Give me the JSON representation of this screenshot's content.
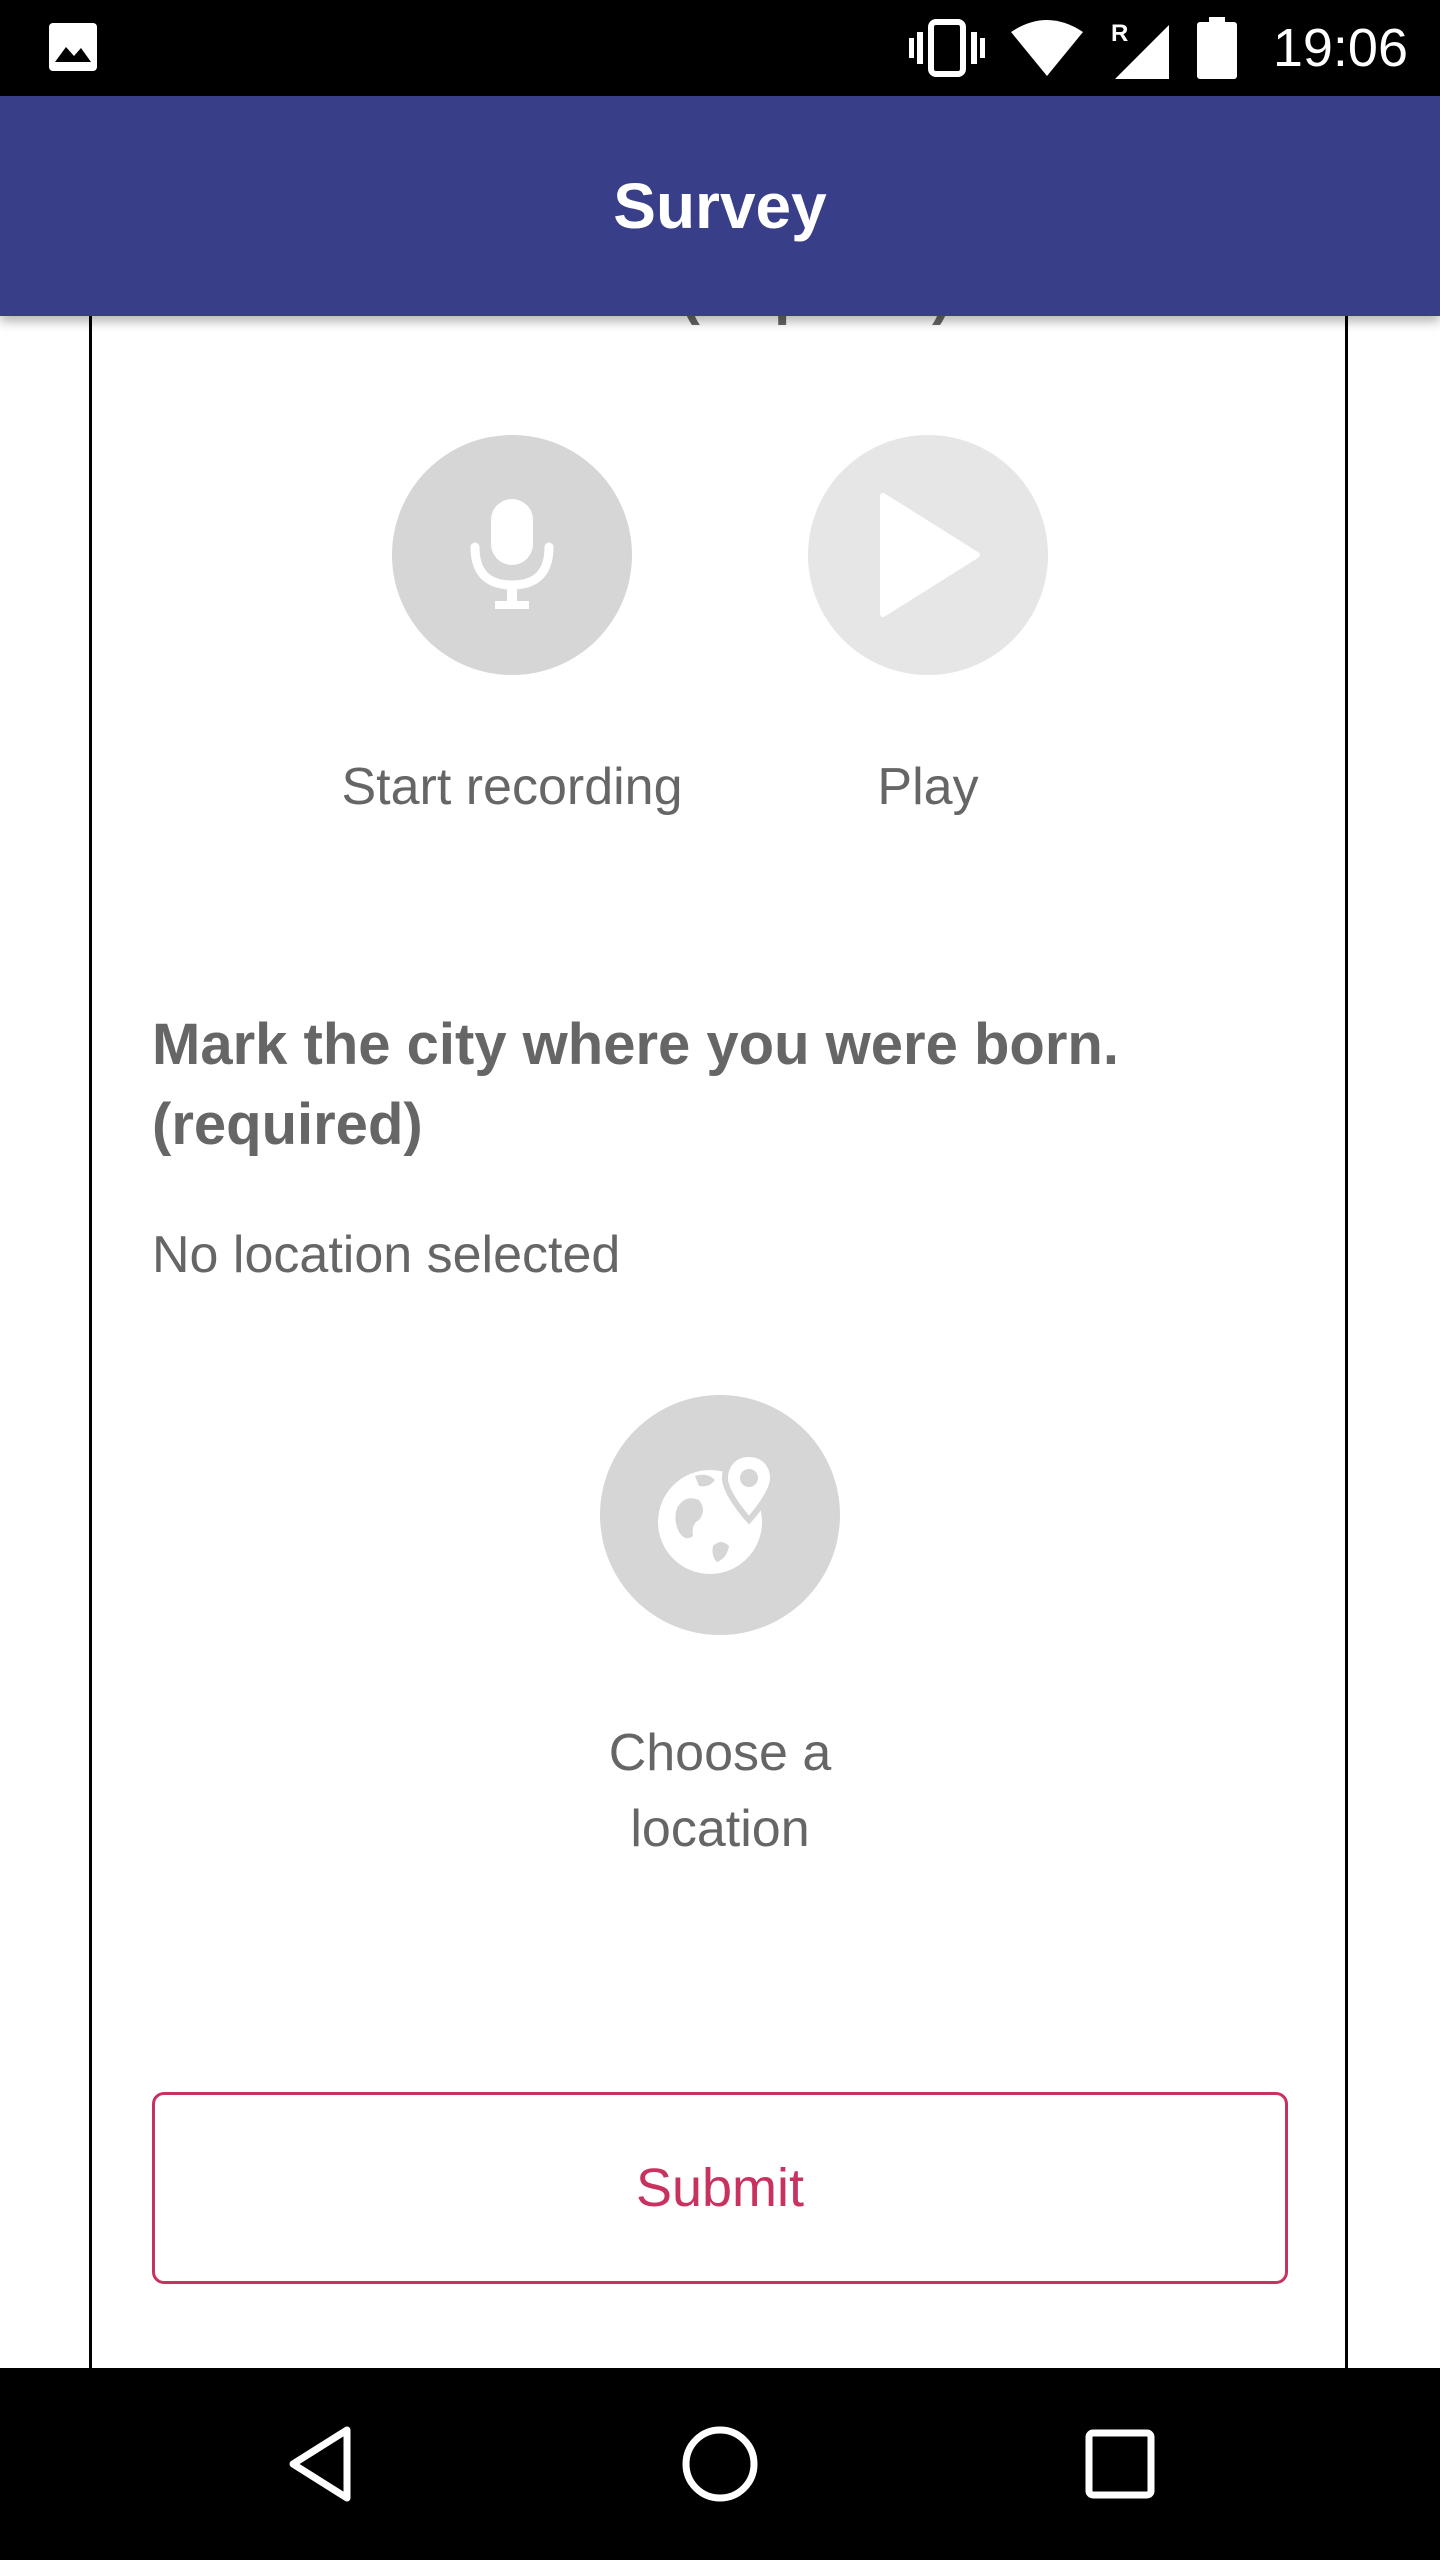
{
  "status_bar": {
    "time": "19:06",
    "icons": [
      "image-icon",
      "vibrate-icon",
      "wifi-icon",
      "signal-roaming-icon",
      "battery-icon"
    ],
    "roaming_label": "R"
  },
  "app_bar": {
    "title": "Survey",
    "color": "#383e87"
  },
  "audio_question": {
    "label": "Make a cow sound (required)",
    "record": {
      "label": "Start recording",
      "icon": "microphone-icon"
    },
    "play": {
      "label": "Play",
      "icon": "play-icon"
    }
  },
  "location_question": {
    "label": "Mark the city where you were born. (required)",
    "status": "No location selected",
    "choose": {
      "label": "Choose a location",
      "icon": "globe-location-icon"
    }
  },
  "submit": {
    "label": "Submit",
    "color": "#c8325f"
  },
  "nav_bar": {
    "icons": [
      "back-icon",
      "home-icon",
      "recents-icon"
    ]
  }
}
